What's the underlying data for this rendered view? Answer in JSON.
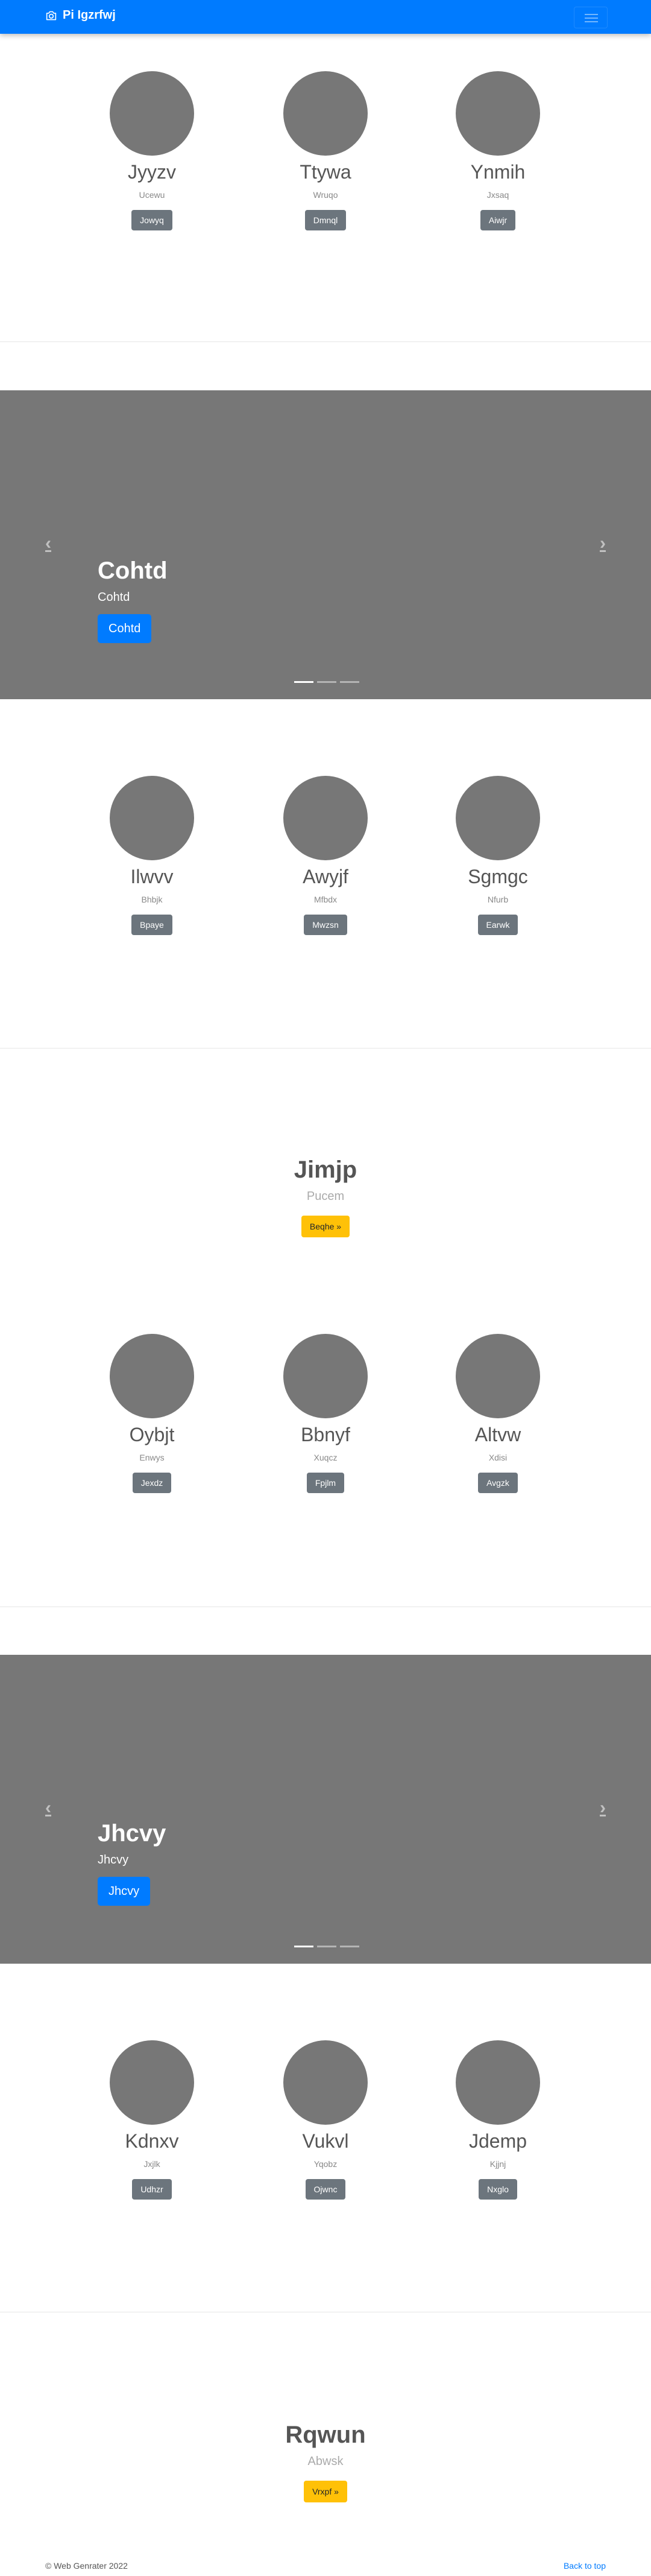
{
  "navbar": {
    "brand": "Pi Igzrfwj",
    "brand_icon": "camera-icon",
    "toggle_icon": "hamburger-icon",
    "color": "#007bff"
  },
  "features_1": [
    {
      "title": "Jyyzv",
      "text": "Ucewu",
      "button": "Jowyq"
    },
    {
      "title": "Ttywa",
      "text": "Wruqo",
      "button": "Dmnql"
    },
    {
      "title": "Ynmih",
      "text": "Jxsaq",
      "button": "Aiwjr"
    }
  ],
  "carousel_1": {
    "title": "Cohtd",
    "text": "Cohtd",
    "button": "Cohtd"
  },
  "features_2": [
    {
      "title": "Ilwvv",
      "text": "Bhbjk",
      "button": "Bpaye"
    },
    {
      "title": "Awyjf",
      "text": "Mfbdx",
      "button": "Mwzsn"
    },
    {
      "title": "Sgmgc",
      "text": "Nfurb",
      "button": "Earwk"
    }
  ],
  "jumbo_1": {
    "title": "Jimjp",
    "text": "Pucem",
    "button": "Beqhe »"
  },
  "features_3": [
    {
      "title": "Oybjt",
      "text": "Enwys",
      "button": "Jexdz"
    },
    {
      "title": "Bbnyf",
      "text": "Xuqcz",
      "button": "Fpjlm"
    },
    {
      "title": "Altvw",
      "text": "Xdisi",
      "button": "Avgzk"
    }
  ],
  "carousel_2": {
    "title": "Jhcvy",
    "text": "Jhcvy",
    "button": "Jhcvy"
  },
  "features_4": [
    {
      "title": "Kdnxv",
      "text": "Jxjlk",
      "button": "Udhzr"
    },
    {
      "title": "Vukvl",
      "text": "Yqobz",
      "button": "Ojwnc"
    },
    {
      "title": "Jdemp",
      "text": "Kjjnj",
      "button": "Nxglo"
    }
  ],
  "jumbo_2": {
    "title": "Rqwun",
    "text": "Abwsk",
    "button": "Vrxpf »"
  },
  "footer": {
    "copyright": "© Web Genrater 2022",
    "back_to_top": "Back to top"
  },
  "carousel_controls": {
    "prev": "‹",
    "next": "›"
  }
}
